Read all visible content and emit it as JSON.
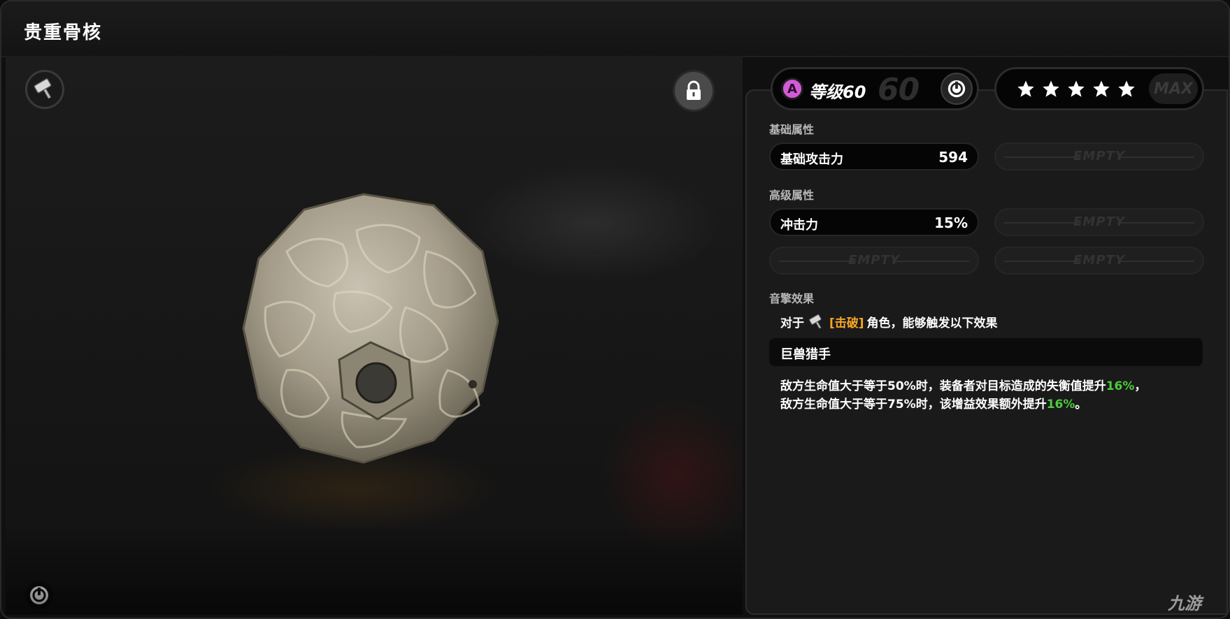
{
  "window": {
    "title": "贵重骨核"
  },
  "item_view": {
    "hammer_button_icon": "hammer-icon",
    "lock_button_icon": "lock-icon",
    "corner_icon": "power-icon"
  },
  "level": {
    "rank": "A",
    "label": "等级60",
    "max_level": "60",
    "icon": "power-icon"
  },
  "stars": {
    "count": 5,
    "max_label": "MAX"
  },
  "base_stats": {
    "section_label": "基础属性",
    "name": "基础攻击力",
    "value": "594",
    "empty_label": "EMPTY"
  },
  "advanced_stats": {
    "section_label": "高级属性",
    "name": "冲击力",
    "value": "15%",
    "empty_label_1": "EMPTY",
    "empty_label_2": "EMPTY",
    "empty_label_3": "EMPTY"
  },
  "effects": {
    "section_label": "音擎效果",
    "for_prefix": "对于",
    "role_tag": "[击破]",
    "for_suffix": "角色，能够触发以下效果",
    "set_name": "巨兽猎手",
    "line1_text": "敌方生命值大于等于50%时，装备者对目标造成的失衡值提升",
    "line1_value": "16%",
    "line1_end": "，",
    "line2_text": "敌方生命值大于等于75%时，该增益效果额外提升",
    "line2_value": "16%",
    "line2_end": "。"
  },
  "watermark": "九游",
  "colors": {
    "rank_badge": "#d25bd6",
    "role_tag": "#f5a623",
    "highlight_value": "#4ccd3a"
  }
}
